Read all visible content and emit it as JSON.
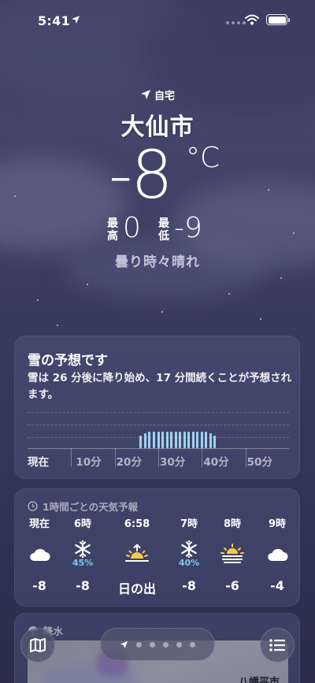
{
  "status_bar": {
    "time": "5:41"
  },
  "header": {
    "home_label": "自宅",
    "city": "大仙市",
    "temperature": "-8",
    "unit": "°C",
    "high_label": "最高",
    "high": "0",
    "low_label": "最低",
    "low": "-9",
    "condition": "曇り時々晴れ"
  },
  "precip_card": {
    "title": "雪の予想です",
    "description": "雪は 26 分後に降り始め、17 分間続くことが予想されます。",
    "axis_labels": [
      "現在",
      "10分",
      "20分",
      "30分",
      "40分",
      "50分"
    ],
    "snow_start_min": 26,
    "snow_duration_min": 17
  },
  "hourly_card": {
    "title": "1時間ごとの天気予報",
    "hours": [
      {
        "time": "現在",
        "icon": "cloud-icon",
        "prob": "",
        "temp": "-8"
      },
      {
        "time": "6時",
        "icon": "snowflake-icon",
        "prob": "45%",
        "temp": "-8"
      },
      {
        "time": "6:58",
        "icon": "sunrise-icon",
        "prob": "",
        "temp": "日の出"
      },
      {
        "time": "7時",
        "icon": "snowflake-icon",
        "prob": "40%",
        "temp": "-8"
      },
      {
        "time": "8時",
        "icon": "sun-haze-icon",
        "prob": "",
        "temp": "-6"
      },
      {
        "time": "9時",
        "icon": "cloud-icon",
        "prob": "",
        "temp": "-4"
      }
    ]
  },
  "precip_map_card": {
    "title": "降水",
    "map_label": "八幡平市"
  },
  "colors": {
    "accent_blue": "#7cc6f3",
    "bar_blue": "#9fd2f0",
    "sun_yellow": "#f7c948"
  }
}
